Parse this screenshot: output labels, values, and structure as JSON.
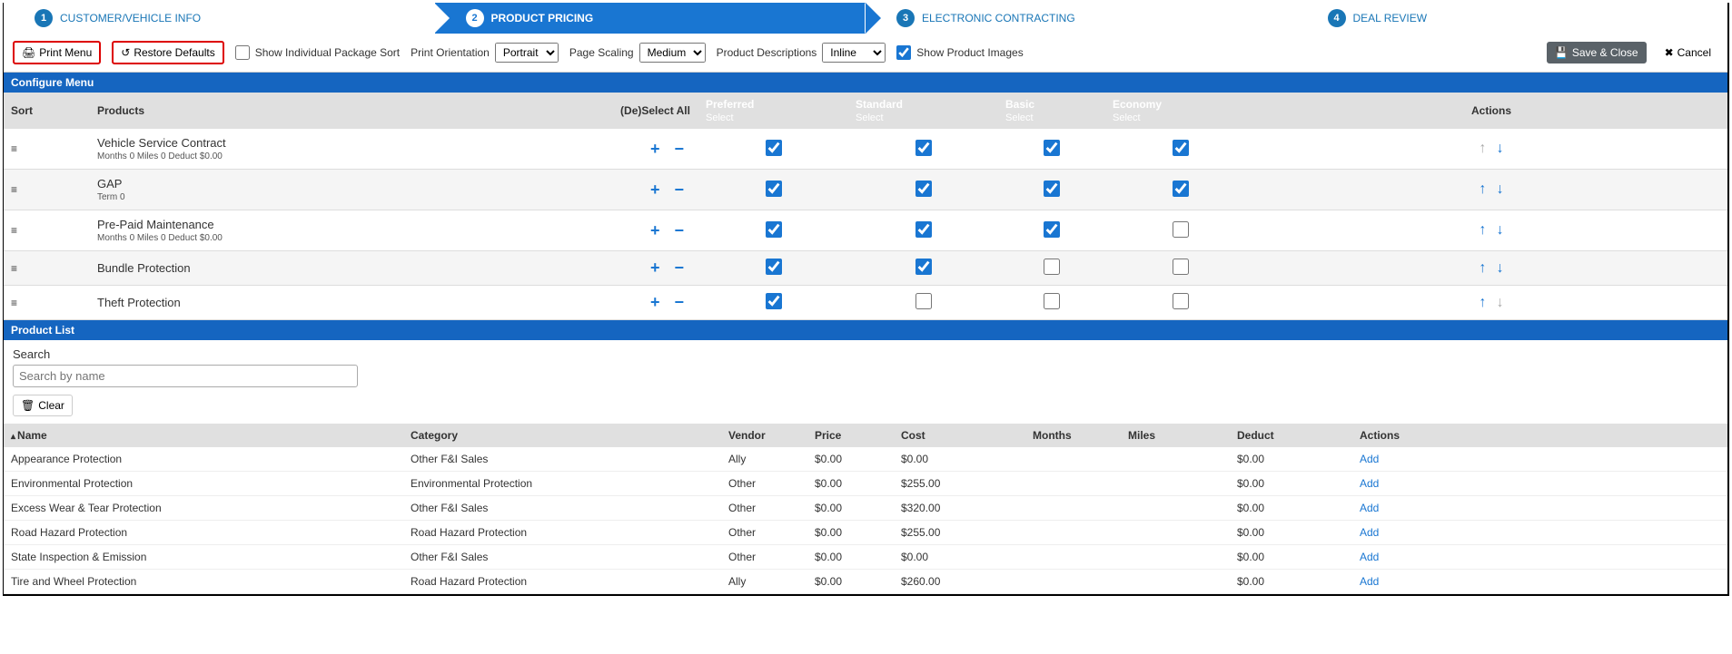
{
  "steps": [
    {
      "num": "1",
      "label": "CUSTOMER/VEHICLE INFO"
    },
    {
      "num": "2",
      "label": "PRODUCT PRICING"
    },
    {
      "num": "3",
      "label": "ELECTRONIC CONTRACTING"
    },
    {
      "num": "4",
      "label": "DEAL REVIEW"
    }
  ],
  "toolbar": {
    "print_menu": "Print Menu",
    "restore_defaults": "Restore Defaults",
    "show_individual": "Show Individual Package Sort",
    "print_orientation_label": "Print Orientation",
    "print_orientation_value": "Portrait",
    "page_scaling_label": "Page Scaling",
    "page_scaling_value": "Medium",
    "product_desc_label": "Product Descriptions",
    "product_desc_value": "Inline",
    "show_images": "Show Product Images",
    "save_close": "Save & Close",
    "cancel": "Cancel"
  },
  "configure_menu_title": "Configure Menu",
  "config_headers": {
    "sort": "Sort",
    "products": "Products",
    "deselect": "(De)Select All",
    "actions": "Actions",
    "select": "Select",
    "packages": [
      {
        "name": "Preferred",
        "cls": "pkg-preferred"
      },
      {
        "name": "Standard",
        "cls": "pkg-standard"
      },
      {
        "name": "Basic",
        "cls": "pkg-basic"
      },
      {
        "name": "Economy",
        "cls": "pkg-economy"
      }
    ]
  },
  "config_rows": [
    {
      "name": "Vehicle Service Contract",
      "sub": "Months 0  Miles 0  Deduct $0.00",
      "checks": [
        true,
        true,
        true,
        true
      ],
      "up": "off",
      "down": "on"
    },
    {
      "name": "GAP",
      "sub": "Term 0",
      "checks": [
        true,
        true,
        true,
        true
      ],
      "up": "on",
      "down": "on",
      "alt": true
    },
    {
      "name": "Pre-Paid Maintenance",
      "sub": "Months 0  Miles 0  Deduct $0.00",
      "checks": [
        true,
        true,
        true,
        false
      ],
      "up": "on",
      "down": "on"
    },
    {
      "name": "Bundle Protection",
      "sub": "",
      "checks": [
        true,
        true,
        false,
        false
      ],
      "up": "on",
      "down": "on",
      "alt": true
    },
    {
      "name": "Theft Protection",
      "sub": "",
      "checks": [
        true,
        false,
        false,
        false
      ],
      "up": "on",
      "down": "off"
    }
  ],
  "product_list_title": "Product List",
  "search_label": "Search",
  "search_placeholder": "Search by name",
  "clear_label": "Clear",
  "list_headers": {
    "name": "Name",
    "category": "Category",
    "vendor": "Vendor",
    "price": "Price",
    "cost": "Cost",
    "months": "Months",
    "miles": "Miles",
    "deduct": "Deduct",
    "actions": "Actions"
  },
  "list_rows": [
    {
      "name": "Appearance Protection",
      "category": "Other F&I Sales",
      "vendor": "Ally",
      "price": "$0.00",
      "cost": "$0.00",
      "months": "",
      "miles": "",
      "deduct": "$0.00",
      "action": "Add"
    },
    {
      "name": "Environmental Protection",
      "category": "Environmental Protection",
      "vendor": "Other",
      "price": "$0.00",
      "cost": "$255.00",
      "months": "",
      "miles": "",
      "deduct": "$0.00",
      "action": "Add"
    },
    {
      "name": "Excess Wear & Tear Protection",
      "category": "Other F&I Sales",
      "vendor": "Other",
      "price": "$0.00",
      "cost": "$320.00",
      "months": "",
      "miles": "",
      "deduct": "$0.00",
      "action": "Add"
    },
    {
      "name": "Road Hazard Protection",
      "category": "Road Hazard Protection",
      "vendor": "Other",
      "price": "$0.00",
      "cost": "$255.00",
      "months": "",
      "miles": "",
      "deduct": "$0.00",
      "action": "Add"
    },
    {
      "name": "State Inspection & Emission",
      "category": "Other F&I Sales",
      "vendor": "Other",
      "price": "$0.00",
      "cost": "$0.00",
      "months": "",
      "miles": "",
      "deduct": "$0.00",
      "action": "Add"
    },
    {
      "name": "Tire and Wheel Protection",
      "category": "Road Hazard Protection",
      "vendor": "Ally",
      "price": "$0.00",
      "cost": "$260.00",
      "months": "",
      "miles": "",
      "deduct": "$0.00",
      "action": "Add"
    }
  ]
}
